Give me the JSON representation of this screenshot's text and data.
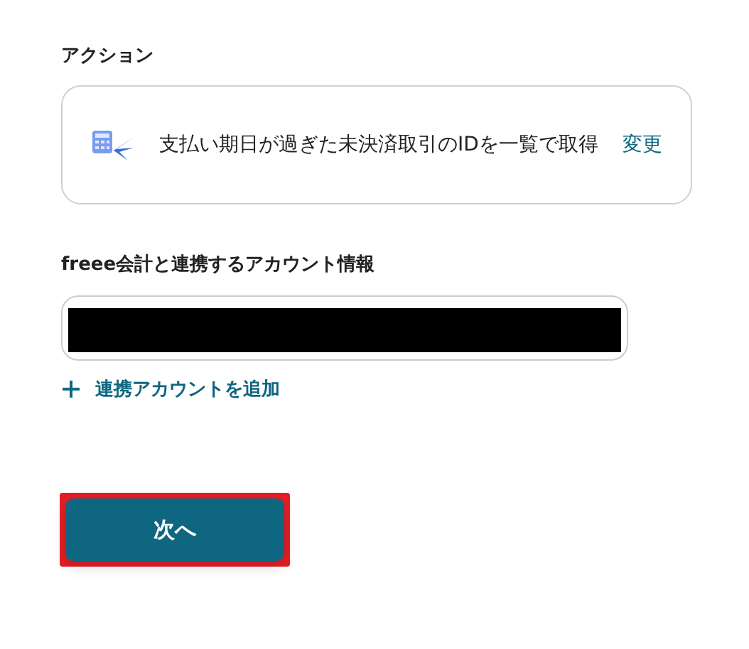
{
  "action_section": {
    "label": "アクション",
    "card": {
      "text": "支払い期日が過ぎた未決済取引のIDを一覧で取得",
      "change_link": "変更"
    }
  },
  "account_section": {
    "label": "freee会計と連携するアカウント情報",
    "field": {
      "redacted": true
    },
    "add_link": "連携アカウントを追加"
  },
  "next_button": {
    "label": "次へ",
    "highlighted": true
  }
}
